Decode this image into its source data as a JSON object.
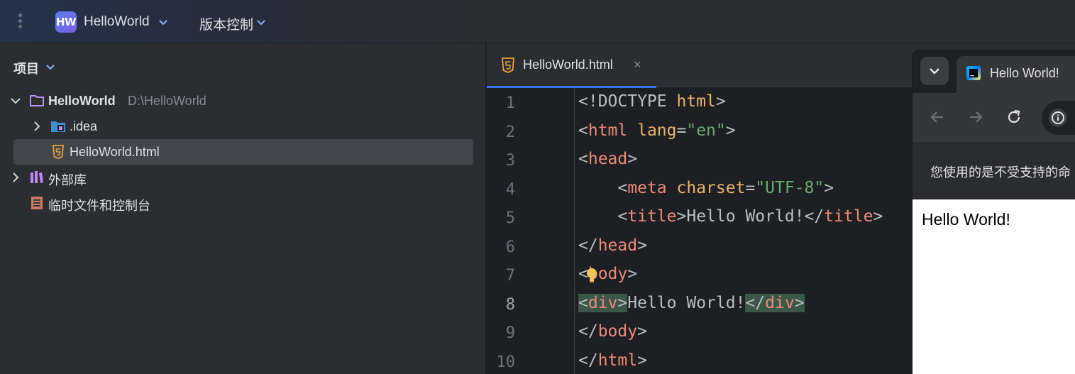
{
  "topbar": {
    "project_badge": "HW",
    "project_name": "HelloWorld",
    "vcs_label": "版本控制"
  },
  "project_panel": {
    "title": "项目",
    "tree": {
      "root_name": "HelloWorld",
      "root_path": "D:\\HelloWorld",
      "idea_folder": ".idea",
      "html_file": "HelloWorld.html",
      "external_libs": "外部库",
      "scratches": "临时文件和控制台"
    }
  },
  "editor": {
    "tab_label": "HelloWorld.html",
    "tab_close": "×",
    "line_numbers": [
      "1",
      "2",
      "3",
      "4",
      "5",
      "6",
      "7",
      "8",
      "9",
      "10"
    ],
    "current_line": "8"
  },
  "browser": {
    "tab_title": "Hello World!",
    "banner_text": "您使用的是不受支持的命",
    "page_text": "Hello World!"
  },
  "colors": {
    "accent": "#3574f0",
    "panel_bg": "#2b2d30",
    "editor_bg": "#1e1f22",
    "html_icon": "#e8a33d",
    "folder_icon": "#b794f6"
  }
}
